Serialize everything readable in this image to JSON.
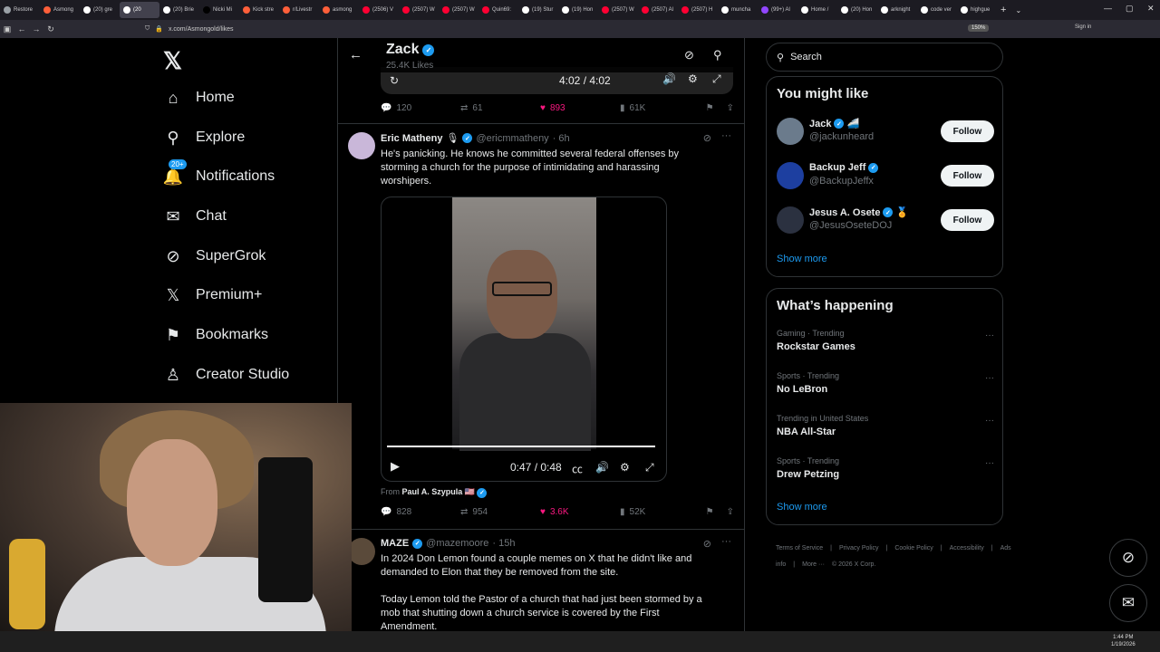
{
  "browser": {
    "tabs": [
      {
        "label": "Restore",
        "color": "#9aa0a6"
      },
      {
        "label": "Asmong",
        "color": "#ff5f3a"
      },
      {
        "label": "(20) gre",
        "color": "#ffffff"
      },
      {
        "label": "(20",
        "color": "#ffffff",
        "active": true
      },
      {
        "label": "(20) Brie",
        "color": "#ffffff"
      },
      {
        "label": "Nicki Mi",
        "color": "#000000"
      },
      {
        "label": "Kick stre",
        "color": "#ff5f3a"
      },
      {
        "label": "r/Livestr",
        "color": "#ff5f3a"
      },
      {
        "label": "asmong",
        "color": "#ff5f3a"
      },
      {
        "label": "(2506) V",
        "color": "#ff0033"
      },
      {
        "label": "(2507) W",
        "color": "#ff0033"
      },
      {
        "label": "(2507) W",
        "color": "#ff0033"
      },
      {
        "label": "Quin69:",
        "color": "#ff0033"
      },
      {
        "label": "(19) Stur",
        "color": "#ffffff"
      },
      {
        "label": "(19) Hon",
        "color": "#ffffff"
      },
      {
        "label": "(2507) W",
        "color": "#ff0033"
      },
      {
        "label": "(2507) Al",
        "color": "#ff0033"
      },
      {
        "label": "(2507) H",
        "color": "#ff0033"
      },
      {
        "label": "muncha",
        "color": "#ffffff"
      },
      {
        "label": "(99+) Al",
        "color": "#9146ff"
      },
      {
        "label": "Home /",
        "color": "#ffffff"
      },
      {
        "label": "(20) Hon",
        "color": "#ffffff"
      },
      {
        "label": "arknight",
        "color": "#ffffff"
      },
      {
        "label": "code ver",
        "color": "#ffffff"
      },
      {
        "label": "highgue",
        "color": "#ffffff"
      }
    ],
    "url": "x.com/Asmongold/likes",
    "zoom": "150%",
    "signin": "Sign in",
    "window_controls": [
      "—",
      "▢",
      "✕"
    ]
  },
  "leftnav": {
    "logo": "𝕏",
    "items": [
      {
        "label": "Home",
        "icon": "⌂",
        "name": "home"
      },
      {
        "label": "Explore",
        "icon": "⚲",
        "name": "explore"
      },
      {
        "label": "Notifications",
        "icon": "🔔",
        "name": "notifications",
        "badge": "20+"
      },
      {
        "label": "Chat",
        "icon": "✉",
        "name": "chat"
      },
      {
        "label": "SuperGrok",
        "icon": "⊘",
        "name": "supergrok"
      },
      {
        "label": "Premium+",
        "icon": "𝕏",
        "name": "premium"
      },
      {
        "label": "Bookmarks",
        "icon": "⚑",
        "name": "bookmarks"
      },
      {
        "label": "Creator Studio",
        "icon": "♙",
        "name": "creator-studio"
      }
    ]
  },
  "feed": {
    "header": {
      "name": "Zack",
      "likes": "25.4K Likes"
    },
    "prev_tweet": {
      "player_time": "4:02 / 4:02",
      "replies": "120",
      "retweets": "61",
      "likes": "893",
      "views": "61K"
    },
    "tweet1": {
      "name": "Eric Matheny",
      "emoji": "🎙",
      "handle": "@ericmmatheny",
      "time": "· 6h",
      "text": "He's panicking. He knows he committed several federal offenses by storming a church for the purpose of intimidating and harassing worshipers.",
      "video_time": "0:47 / 0:48",
      "video_progress": 0.98,
      "from_label": "From",
      "from_name": "Paul A. Szypula 🇺🇸",
      "replies": "828",
      "retweets": "954",
      "likes": "3.6K",
      "views": "52K"
    },
    "tweet2": {
      "name": "MAZE",
      "handle": "@mazemoore",
      "time": "· 15h",
      "text1": "In 2024 Don Lemon found a couple memes on X that he didn't like and demanded to Elon that they be removed from the site.",
      "text2": "Today Lemon told the Pastor of a church that had just been stormed by a mob that shutting down a church service is covered by the First Amendment."
    }
  },
  "rightcol": {
    "search_placeholder": "Search",
    "you_might_like": {
      "title": "You might like",
      "people": [
        {
          "name": "Jack",
          "extra": "🚄",
          "handle": "@jackunheard",
          "button": "Follow",
          "color": "#6b7b8c"
        },
        {
          "name": "Backup Jeff",
          "extra": "",
          "handle": "@BackupJeffx",
          "button": "Follow",
          "color": "#1d3fa0"
        },
        {
          "name": "Jesus A. Osete",
          "extra": "🏅",
          "handle": "@JesusOseteDOJ",
          "button": "Follow",
          "color": "#2b3140"
        }
      ],
      "show_more": "Show more"
    },
    "whats_happening": {
      "title": "What’s happening",
      "trends": [
        {
          "context": "Gaming · Trending",
          "title": "Rockstar Games"
        },
        {
          "context": "Sports · Trending",
          "title": "No LeBron"
        },
        {
          "context": "Trending in United States",
          "title": "NBA All-Star"
        },
        {
          "context": "Sports · Trending",
          "title": "Drew Petzing"
        }
      ],
      "show_more": "Show more"
    },
    "footer": {
      "links": [
        "Terms of Service",
        "|",
        "Privacy Policy",
        "|",
        "Cookie Policy",
        "|",
        "Accessibility",
        "|",
        "Ads info",
        "|",
        "More ···",
        "© 2026 X Corp."
      ]
    }
  },
  "taskbar": {
    "time": "1:44 PM",
    "date": "1/19/2026"
  },
  "colors": {
    "accent": "#1d9bf0",
    "like": "#f91880",
    "border": "#2f3336"
  }
}
